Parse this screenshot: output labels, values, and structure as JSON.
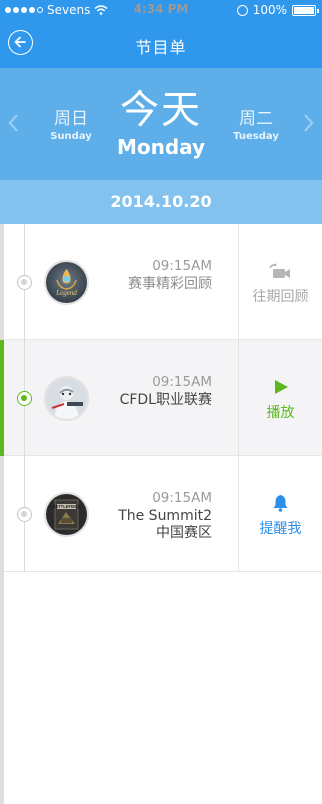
{
  "status_bar": {
    "carrier": "Sevens",
    "time": "4:34 PM",
    "battery": "100%"
  },
  "header": {
    "title": "节目单",
    "back_icon": "back-arrow-circle-icon"
  },
  "day_selector": {
    "prev": {
      "cn": "周日",
      "en": "Sunday"
    },
    "current": {
      "cn": "今天",
      "en": "Monday"
    },
    "next": {
      "cn": "周二",
      "en": "Tuesday"
    }
  },
  "date": "2014.10.20",
  "colors": {
    "header_bg": "#2f97ec",
    "day_bar_bg": "#5daee9",
    "date_bar_bg": "#83c1ef",
    "active_green": "#5cb81d",
    "remind_blue": "#2f8fe8"
  },
  "programs": [
    {
      "time": "09:15AM",
      "name": "赛事精彩回顾",
      "action": "往期回顾",
      "action_icon": "replay-camera-icon",
      "state": "past"
    },
    {
      "time": "09:15AM",
      "name": "CFDL职业联赛",
      "action": "播放",
      "action_icon": "play-icon",
      "state": "live"
    },
    {
      "time": "09:15AM",
      "name_line1": "The Summit2",
      "name_line2": "中国赛区",
      "action": "提醒我",
      "action_icon": "bell-icon",
      "state": "upcoming"
    }
  ]
}
